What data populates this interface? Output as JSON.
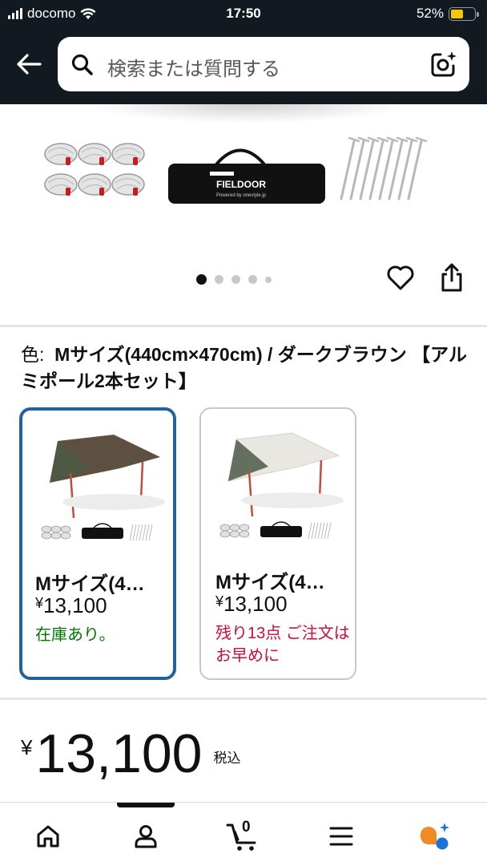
{
  "status": {
    "carrier": "docomo",
    "time": "17:50",
    "battery": "52%"
  },
  "search": {
    "placeholder": "検索または質問する"
  },
  "gallery": {
    "brand_text": "FIELDOOR",
    "brand_sub": "Powered by onestyle.jp",
    "slide_count": 5,
    "active_slide": 1
  },
  "variant": {
    "label": "色:",
    "value": "Mサイズ(440cm×470cm) / ダークブラウン 【アルミポール2本セット】",
    "options": [
      {
        "name": "Mサイズ(4…",
        "yen": "¥",
        "price": "13,100",
        "stock": "在庫あり。",
        "stock_color": "#007600",
        "tarp_color": "#5e5040",
        "selected": true
      },
      {
        "name": "Mサイズ(4…",
        "yen": "¥",
        "price": "13,100",
        "stock": "残り13点 ご注文はお早めに",
        "stock_color": "#cc0c39",
        "tarp_color": "#e9e7e2",
        "selected": false
      }
    ]
  },
  "price": {
    "yen": "¥",
    "amount": "13,100",
    "tax": "税込"
  },
  "nav": {
    "cart_count": "0",
    "items": [
      "home-icon",
      "account-icon",
      "cart-icon",
      "menu-icon",
      "rufus-icon"
    ]
  },
  "colors": {
    "header": "#131921",
    "selected_border": "#2162a1",
    "in_stock": "#007600",
    "low_stock": "#cc0c39"
  }
}
